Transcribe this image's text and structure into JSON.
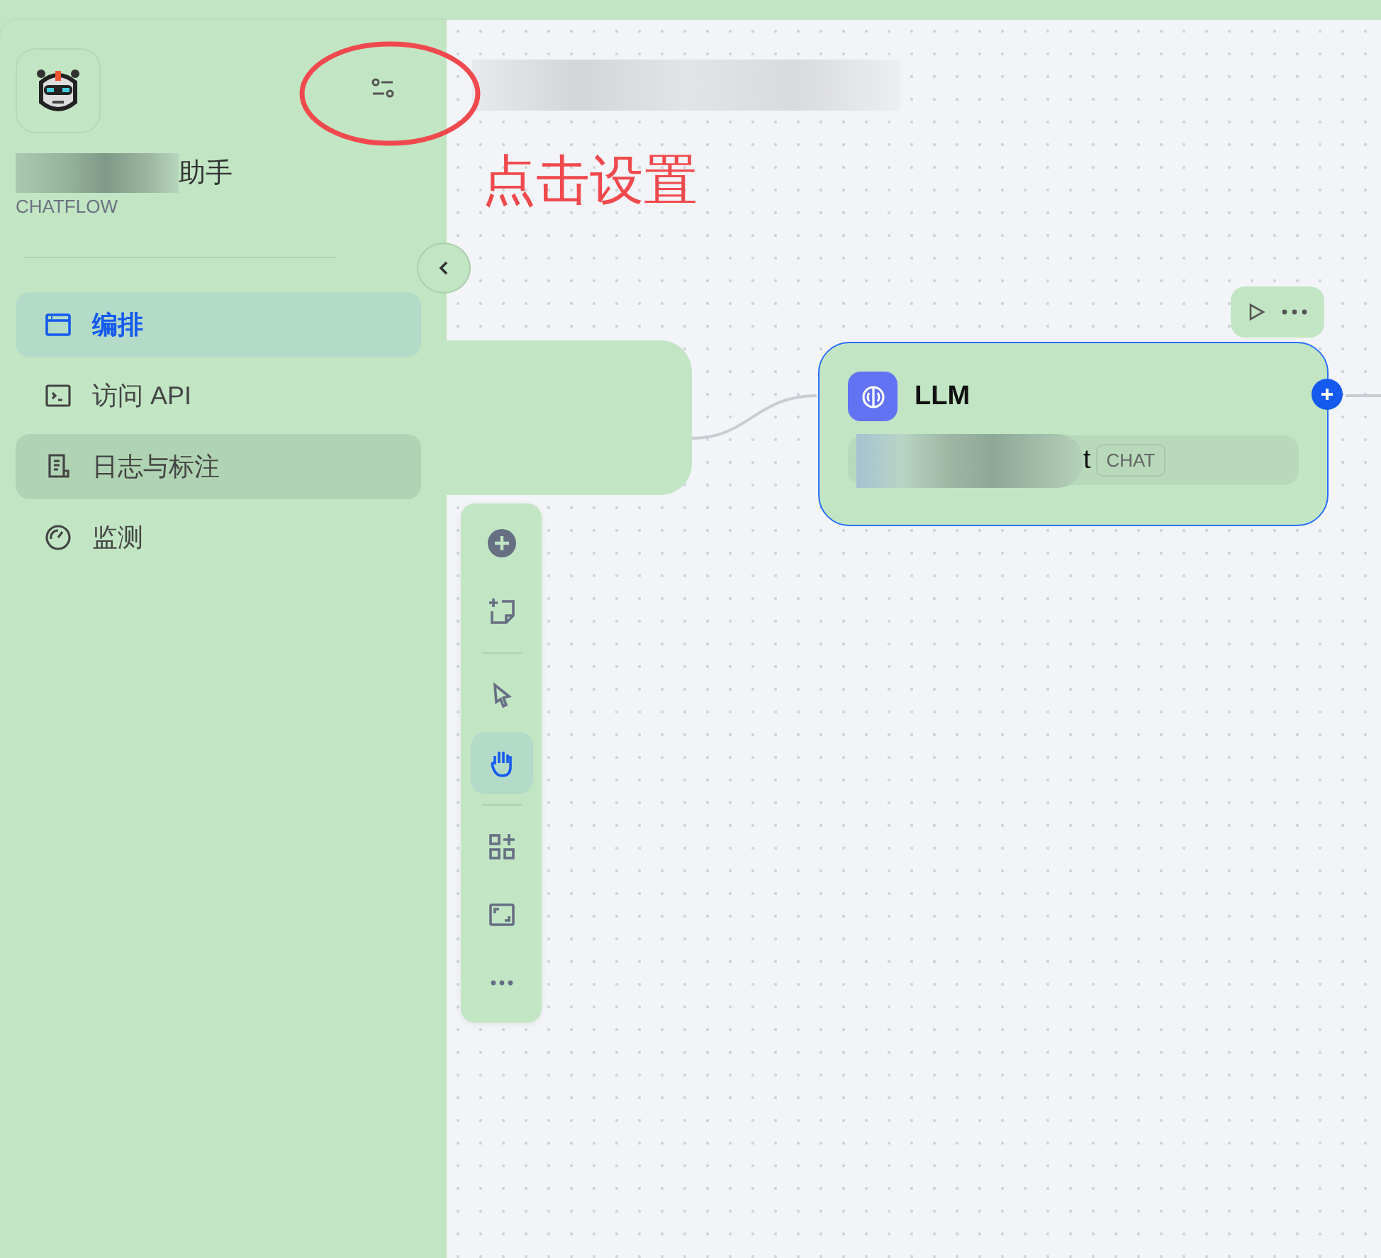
{
  "app": {
    "name_visible": "助手",
    "type": "CHATFLOW"
  },
  "sidebar": {
    "items": [
      {
        "label": "编排",
        "kind": "layout",
        "selected": true,
        "hovered": false
      },
      {
        "label": "访问 API",
        "kind": "terminal",
        "selected": false,
        "hovered": false
      },
      {
        "label": "日志与标注",
        "kind": "log",
        "selected": false,
        "hovered": true
      },
      {
        "label": "监测",
        "kind": "gauge",
        "selected": false,
        "hovered": false
      }
    ]
  },
  "annotation": {
    "text": "点击设置"
  },
  "llm_node": {
    "title": "LLM",
    "model_visible": "t",
    "model_badge": "CHAT"
  },
  "toolbar": {
    "tools": [
      {
        "kind": "add",
        "selected": false
      },
      {
        "kind": "note",
        "selected": false
      },
      {
        "kind": "pointer",
        "selected": false
      },
      {
        "kind": "hand",
        "selected": true
      },
      {
        "kind": "organize",
        "selected": false
      },
      {
        "kind": "fit",
        "selected": false
      },
      {
        "kind": "more",
        "selected": false
      }
    ]
  }
}
